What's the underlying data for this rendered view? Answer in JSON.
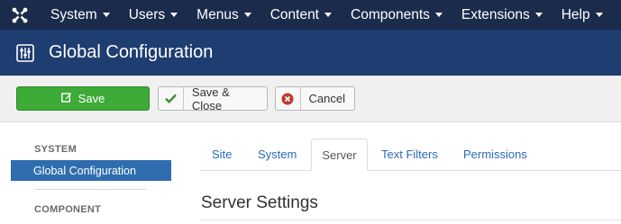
{
  "topnav": {
    "logo_icon": "joomla-logo-icon",
    "items": [
      {
        "label": "System"
      },
      {
        "label": "Users"
      },
      {
        "label": "Menus"
      },
      {
        "label": "Content"
      },
      {
        "label": "Components"
      },
      {
        "label": "Extensions"
      },
      {
        "label": "Help"
      }
    ]
  },
  "header": {
    "icon": "equalizer-icon",
    "title": "Global Configuration"
  },
  "toolbar": {
    "save_label": "Save",
    "save_icon": "edit-icon",
    "save_close_label": "Save & Close",
    "save_close_icon": "checkmark-icon",
    "cancel_label": "Cancel",
    "cancel_icon": "cancel-circle-icon"
  },
  "sidebar": {
    "system_heading": "SYSTEM",
    "active_item": "Global Configuration",
    "component_heading": "COMPONENT"
  },
  "tabs": [
    {
      "label": "Site"
    },
    {
      "label": "System"
    },
    {
      "label": "Server"
    },
    {
      "label": "Text Filters"
    },
    {
      "label": "Permissions"
    }
  ],
  "active_tab": "Server",
  "main": {
    "section_title": "Server Settings"
  },
  "colors": {
    "topnav_bg": "#1a2b4b",
    "header_bg": "#1e3d70",
    "save_green": "#3eaa38",
    "sidebar_active": "#2f6dae",
    "tab_link": "#2a69b8",
    "cancel_red": "#c0392b"
  }
}
